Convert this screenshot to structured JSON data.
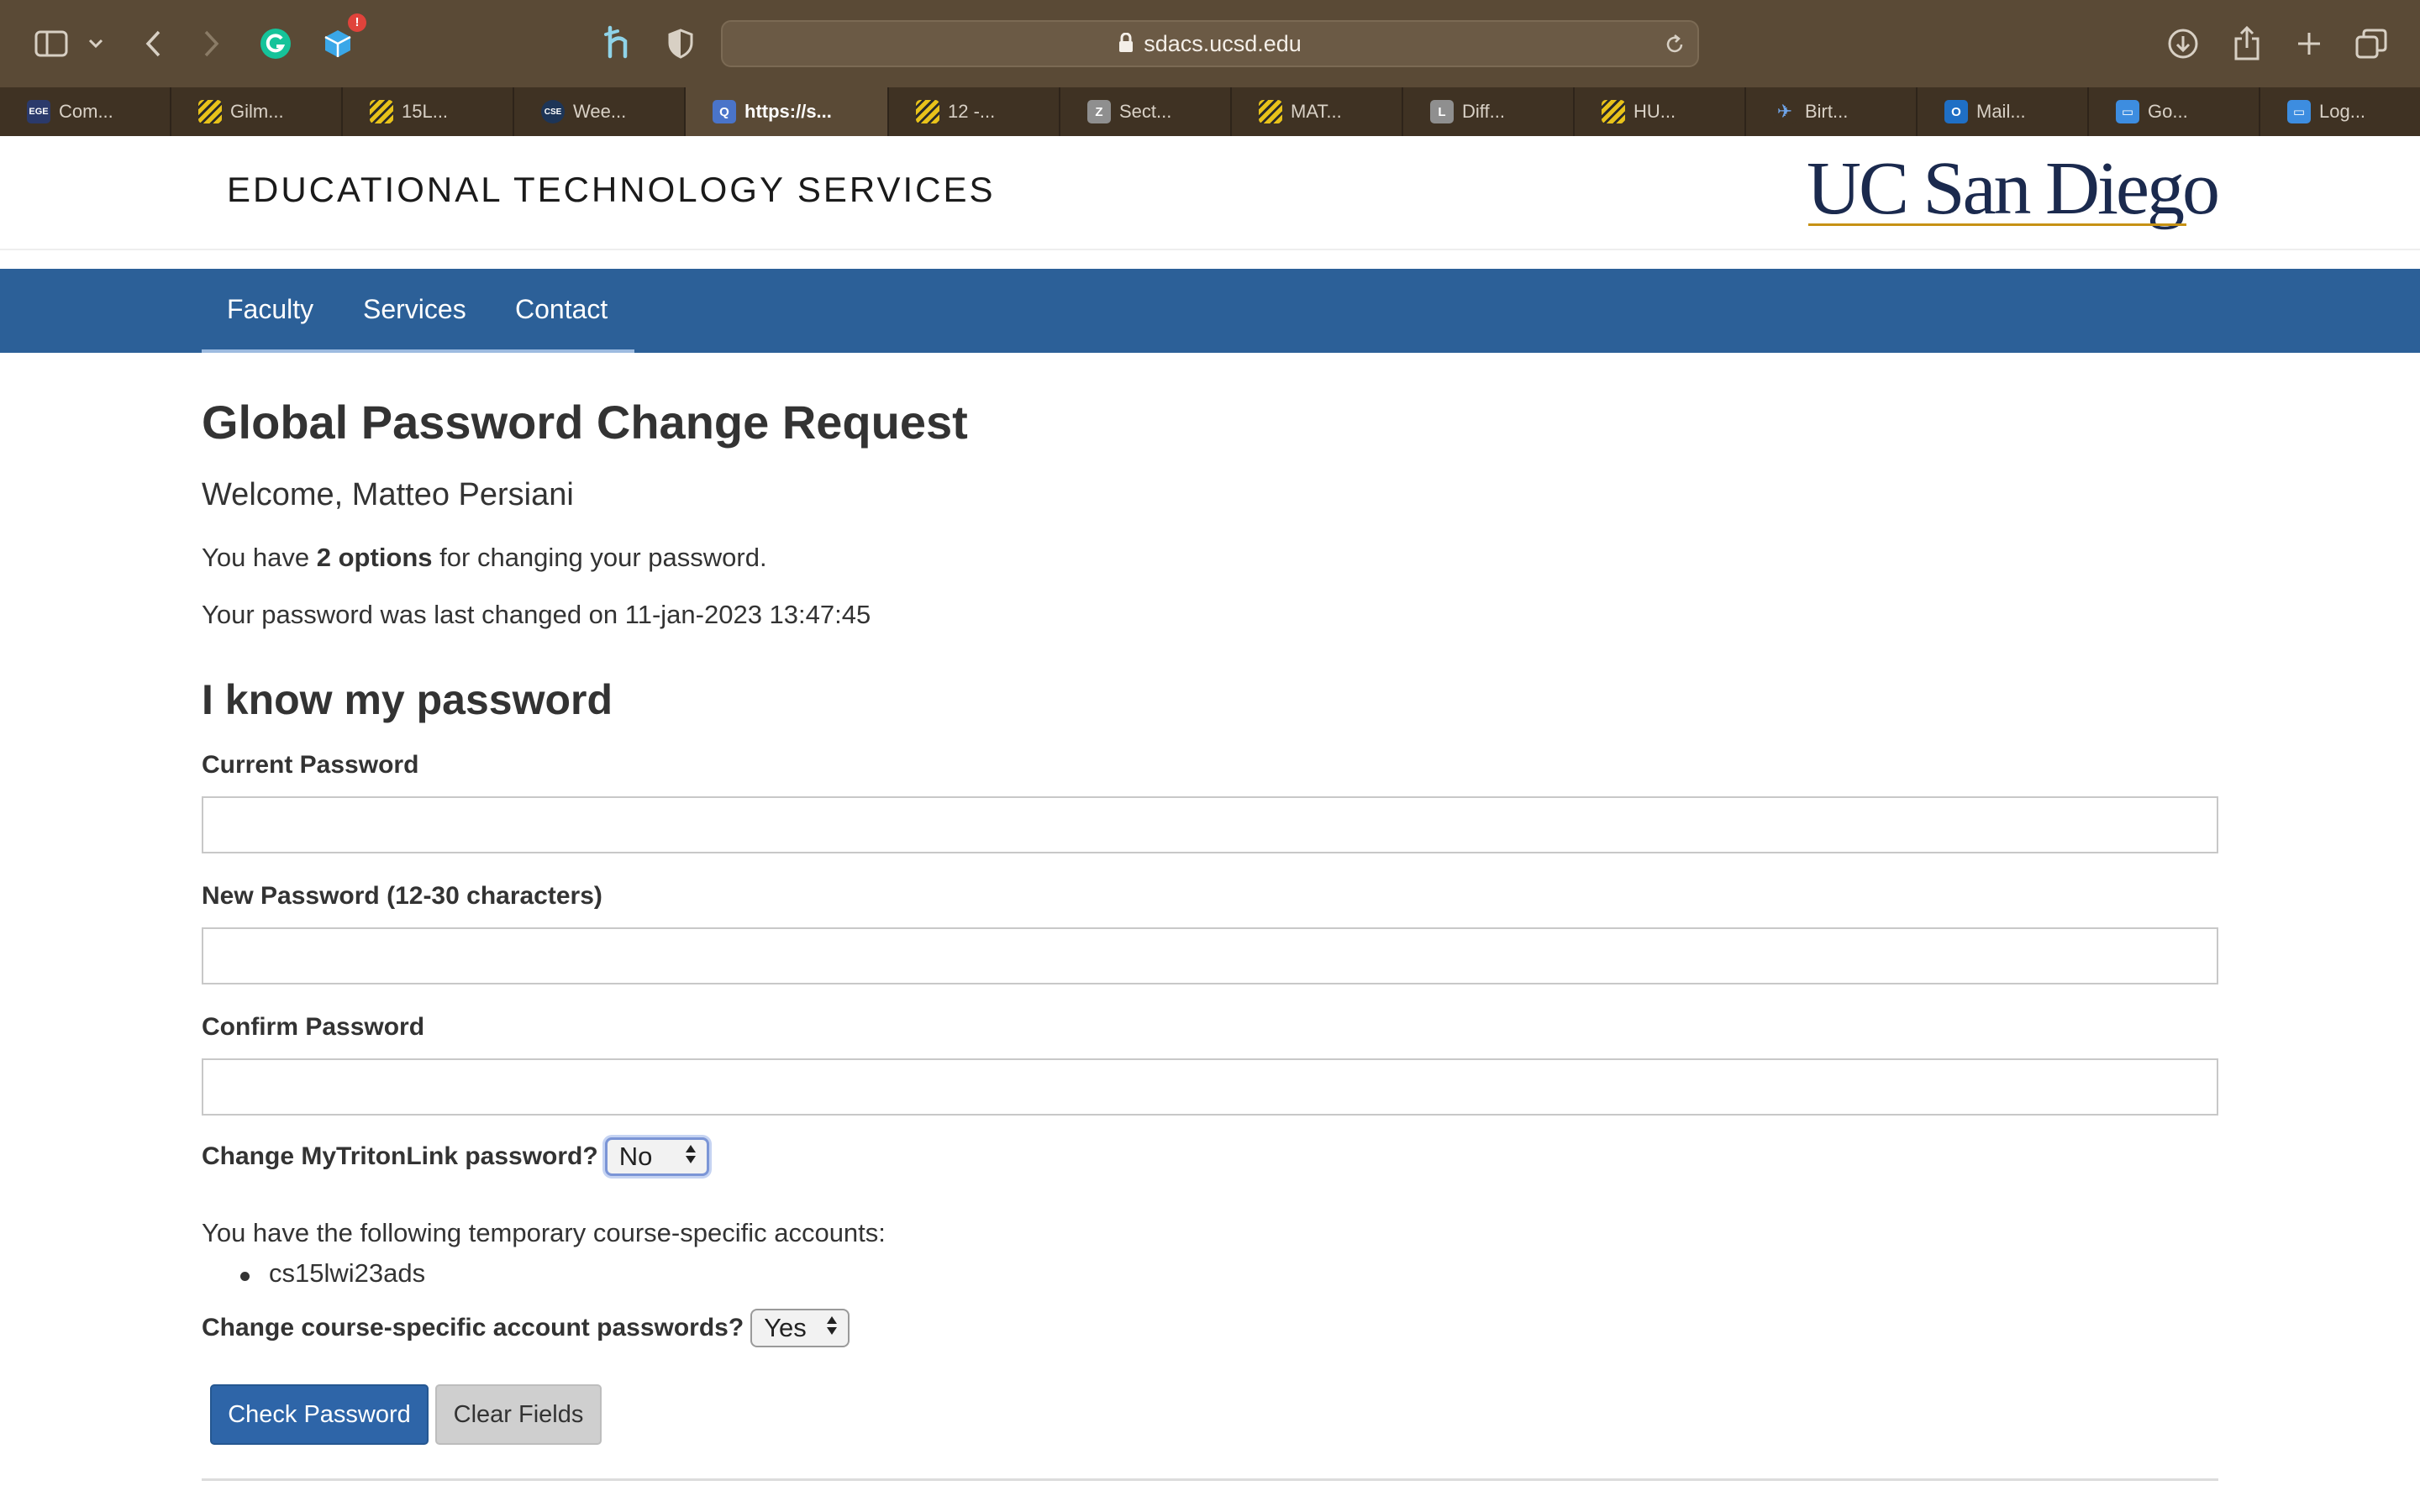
{
  "browser": {
    "url": "sdacs.ucsd.edu",
    "grammarly_badge": "!",
    "tabs": [
      {
        "label": "Com...",
        "favicon_text": "EGE",
        "favicon_color": "#2b3a6b"
      },
      {
        "label": "Gilm...",
        "favicon_text": "",
        "favicon_color": "#e8c21a"
      },
      {
        "label": "15L...",
        "favicon_text": "",
        "favicon_color": "#e8c21a"
      },
      {
        "label": "Wee...",
        "favicon_text": "CSE",
        "favicon_color": "#1d3557"
      },
      {
        "label": "https://s...",
        "favicon_text": "Q",
        "favicon_color": "#4a74c9",
        "active": true
      },
      {
        "label": "12 -...",
        "favicon_text": "",
        "favicon_color": "#e8c21a"
      },
      {
        "label": "Sect...",
        "favicon_text": "Z",
        "favicon_color": "#8f8f8f"
      },
      {
        "label": "MAT...",
        "favicon_text": "",
        "favicon_color": "#e8c21a"
      },
      {
        "label": "Diff...",
        "favicon_text": "L",
        "favicon_color": "#8f8f8f"
      },
      {
        "label": "HU...",
        "favicon_text": "",
        "favicon_color": "#e8c21a"
      },
      {
        "label": "Birt...",
        "favicon_text": "✈",
        "favicon_color": "#3f3223"
      },
      {
        "label": "Mail...",
        "favicon_text": "O",
        "favicon_color": "#1f6fc5"
      },
      {
        "label": "Go...",
        "favicon_text": "▭",
        "favicon_color": "#3d8de0"
      },
      {
        "label": "Log...",
        "favicon_text": "▭",
        "favicon_color": "#3d8de0"
      }
    ]
  },
  "site": {
    "title": "EDUCATIONAL TECHNOLOGY SERVICES",
    "logo": "UC San Diego",
    "nav": [
      "Faculty",
      "Services",
      "Contact"
    ]
  },
  "main": {
    "page_title": "Global Password Change Request",
    "welcome": "Welcome, Matteo Persiani",
    "options_prefix": "You have ",
    "options_bold": "2 options",
    "options_suffix": " for changing your password.",
    "last_changed": "Your password was last changed on 11-jan-2023 13:47:45",
    "section_title": "I know my password",
    "current_password_label": "Current Password",
    "new_password_label": "New Password (12-30 characters)",
    "confirm_password_label": "Confirm Password",
    "current_password_value": "",
    "new_password_value": "",
    "confirm_password_value": "",
    "mytritonlink_label": "Change MyTritonLink password?",
    "mytritonlink_value": "No",
    "temp_accounts_text": "You have the following temporary course-specific accounts:",
    "temp_accounts": [
      "cs15lwi23ads"
    ],
    "course_accounts_label": "Change course-specific account passwords?",
    "course_accounts_value": "Yes",
    "check_button": "Check Password",
    "clear_button": "Clear Fields"
  },
  "colors": {
    "toolbar": "#5a4a36",
    "tabstrip": "#3f3223",
    "navbar": "#2c6098",
    "primary_button": "#2e65a8",
    "logo_navy": "#1b2a4e",
    "logo_gold": "#c69214"
  }
}
